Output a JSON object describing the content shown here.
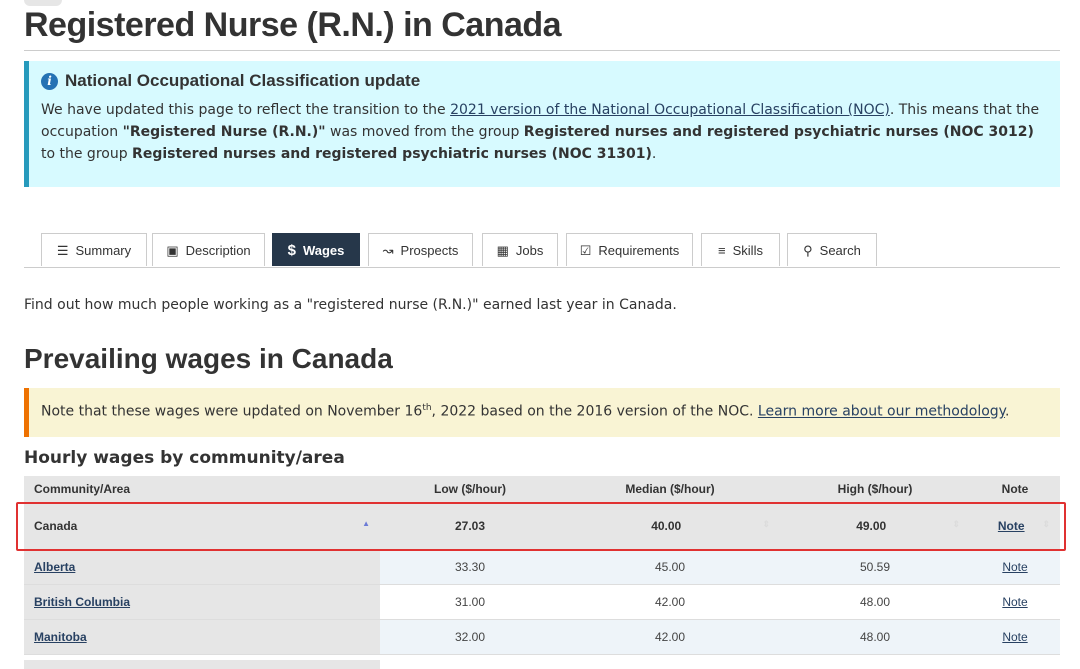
{
  "page": {
    "title": "Registered Nurse (R.N.) in Canada"
  },
  "noc_alert": {
    "heading": "National Occupational Classification update",
    "text_1": "We have updated this page to reflect the transition to the ",
    "link": "2021 version of the National Occupational Classification (NOC)",
    "text_2": ". This means that the occupation ",
    "occupation": "\"Registered Nurse (R.N.)\"",
    "text_3": " was moved from the group ",
    "old_group": "Registered nurses and registered psychiatric nurses (NOC 3012)",
    "text_4": " to the group ",
    "new_group": "Registered nurses and registered psychiatric nurses (NOC 31301)",
    "text_5": "."
  },
  "tabs": [
    {
      "label": "Summary",
      "icon": "list-icon"
    },
    {
      "label": "Description",
      "icon": "book-icon"
    },
    {
      "label": "Wages",
      "icon": "dollar-icon",
      "active": true
    },
    {
      "label": "Prospects",
      "icon": "trend-chart-icon"
    },
    {
      "label": "Jobs",
      "icon": "newspaper-icon"
    },
    {
      "label": "Requirements",
      "icon": "checkbox-icon"
    },
    {
      "label": "Skills",
      "icon": "checklist-icon"
    },
    {
      "label": "Search",
      "icon": "search-icon"
    }
  ],
  "intro": "Find out how much people working as a \"registered nurse (R.N.)\" earned last year in Canada.",
  "prevailing": {
    "heading": "Prevailing wages in Canada"
  },
  "update_note": {
    "text_1": "Note that these wages were updated on November 16",
    "sup": "th",
    "text_2": ", 2022 based on the 2016 version of the NOC. ",
    "link": "Learn more about our methodology",
    "text_3": "."
  },
  "table": {
    "title": "Hourly wages by community/area",
    "headers": {
      "community": "Community/Area",
      "low": "Low ($/hour)",
      "median": "Median ($/hour)",
      "high": "High ($/hour)",
      "note": "Note"
    },
    "rows": [
      {
        "community": "Canada",
        "low": "27.03",
        "median": "40.00",
        "high": "49.00",
        "note": "Note"
      },
      {
        "community": "Alberta",
        "low": "33.30",
        "median": "45.00",
        "high": "50.59",
        "note": "Note"
      },
      {
        "community": "British Columbia",
        "low": "31.00",
        "median": "42.00",
        "high": "48.00",
        "note": "Note"
      },
      {
        "community": "Manitoba",
        "low": "32.00",
        "median": "42.00",
        "high": "48.00",
        "note": "Note"
      }
    ]
  },
  "colors": {
    "accent": "#26374a",
    "link": "#284162",
    "info_bg": "#d7faff",
    "warning_bg": "#f9f4d4",
    "highlight": "#e03131"
  }
}
